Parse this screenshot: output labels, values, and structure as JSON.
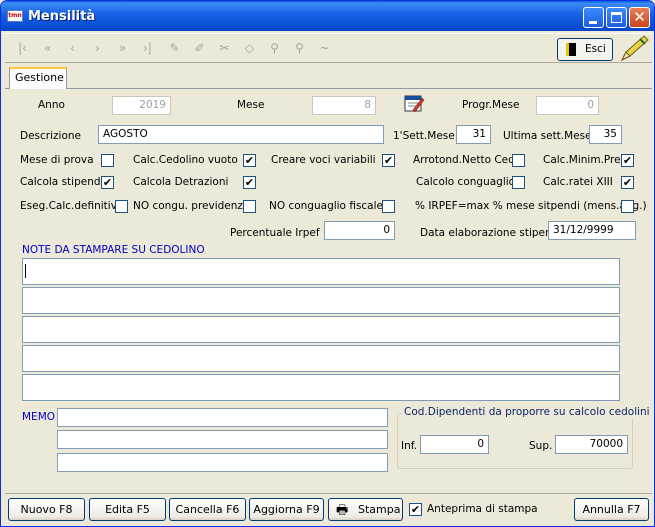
{
  "window": {
    "title": "Mensilità",
    "app_icon": "tmn"
  },
  "toolbar": {
    "tools": [
      "first-record-icon",
      "prev-page-icon",
      "prev-record-icon",
      "next-record-icon",
      "next-page-icon",
      "last-record-icon",
      "add-record-icon",
      "edit-record-icon",
      "delete-record-icon",
      "eraser-icon",
      "search-icon",
      "search-person-icon",
      "undo-icon"
    ],
    "exit_label": "Esci"
  },
  "tabs": [
    {
      "label": "Gestione"
    }
  ],
  "form": {
    "anno_label": "Anno",
    "anno_value": "2019",
    "mese_label": "Mese",
    "mese_value": "8",
    "progr_mese_label": "Progr.Mese",
    "progr_mese_value": "0",
    "descrizione_label": "Descrizione",
    "descrizione_value": "AGOSTO",
    "primo_sett_label": "1'Sett.Mese",
    "primo_sett_value": "31",
    "ultima_sett_label": "Ultima sett.Mese",
    "ultima_sett_value": "35",
    "percentuale_label": "Percentuale Irpef",
    "percentuale_value": "0",
    "data_elab_label": "Data elaborazione stipendi",
    "data_elab_value": "31/12/9999"
  },
  "checkboxes": {
    "mese_prova": {
      "label": "Mese di prova",
      "checked": false
    },
    "calc_cedolino_vuoto": {
      "label": "Calc.Cedolino vuoto",
      "checked": true
    },
    "creare_voci": {
      "label": "Creare voci variabili",
      "checked": true
    },
    "arrotond_netto": {
      "label": "Arrotond.Netto Ced.",
      "checked": false
    },
    "calc_minim_prev": {
      "label": "Calc.Minim.Prev.",
      "checked": true
    },
    "calcola_stipendio": {
      "label": "Calcola stipendio",
      "checked": true
    },
    "calcola_detrazioni": {
      "label": "Calcola Detrazioni",
      "checked": true
    },
    "calcolo_conguaglio": {
      "label": "Calcolo conguaglio",
      "checked": false
    },
    "calc_ratei": {
      "label": "Calc.ratei XIII",
      "checked": true
    },
    "eseg_calc_def": {
      "label": "Eseg.Calc.definitivo",
      "checked": false
    },
    "no_congu_prev": {
      "label": "NO congu. previdenz.",
      "checked": false
    },
    "no_congu_fiscale": {
      "label": "NO conguaglio fiscale",
      "checked": false
    },
    "irpef_max": {
      "label": "% IRPEF=max % mese sitpendi (mens.agg.)",
      "checked": false
    }
  },
  "note": {
    "title": "NOTE DA STAMPARE SU CEDOLINO",
    "lines": [
      "",
      "",
      "",
      "",
      ""
    ]
  },
  "memo": {
    "label": "MEMO",
    "lines": [
      "",
      "",
      ""
    ]
  },
  "dipendenti": {
    "title": "Cod.Dipendenti da proporre su calcolo cedolini",
    "inf_label": "Inf.",
    "inf_value": "0",
    "sup_label": "Sup.",
    "sup_value": "70000"
  },
  "buttons": {
    "nuovo": "Nuovo F8",
    "edita": "Edita F5",
    "cancella": "Cancella F6",
    "aggiorna": "Aggiorna F9",
    "stampa": "Stampa",
    "anteprima_label": "Anteprima di stampa",
    "anteprima_checked": true,
    "annulla": "Annulla F7"
  }
}
